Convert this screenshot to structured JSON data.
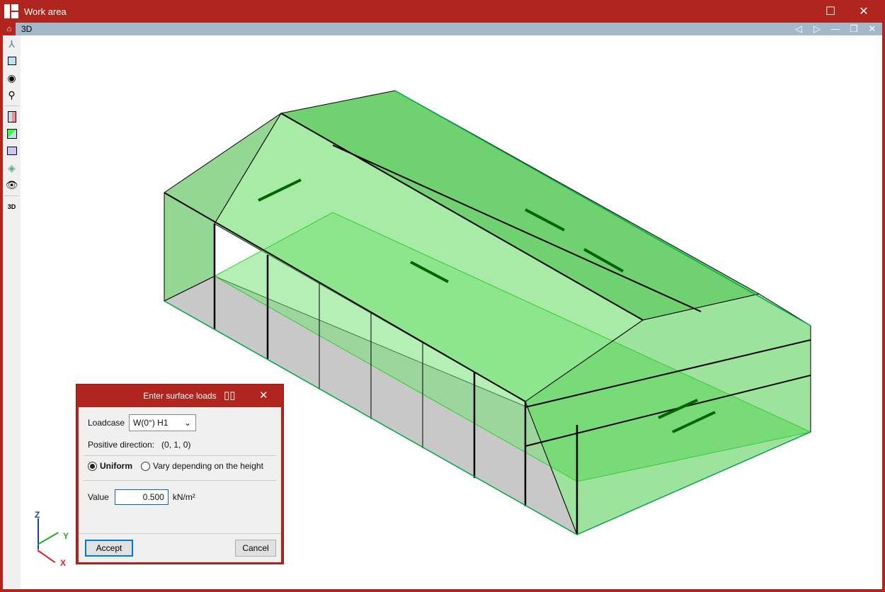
{
  "window": {
    "title": "Work area",
    "maximize_icon": "maximize-icon",
    "close_icon": "close-icon"
  },
  "view": {
    "title": "3D"
  },
  "toolbar": {
    "items": [
      "axes-icon",
      "view-cube-icon",
      "orbit-icon",
      "rotate-icon",
      "section-icon",
      "surface-icon",
      "plane-icon",
      "layers-icon",
      "hide-icon",
      "3d-settings-icon"
    ],
    "settings_label": "3D"
  },
  "axes": {
    "z": "Z",
    "y": "Y",
    "x": "X"
  },
  "dialog": {
    "title": "Enter surface loads",
    "loadcase_label": "Loadcase",
    "loadcase_value": "W(0°) H1",
    "direction_label": "Positive direction:",
    "direction_value": "(0, 1, 0)",
    "uniform_label": "Uniform",
    "vary_label": "Vary depending on the height",
    "value_label": "Value",
    "value": "0.500",
    "unit": "kN/m²",
    "accept": "Accept",
    "cancel": "Cancel"
  },
  "colors": {
    "frame": "#b0261e",
    "subbar": "#a4b8cc",
    "roof": "#33cc33",
    "wall": "#c8c8c8"
  }
}
